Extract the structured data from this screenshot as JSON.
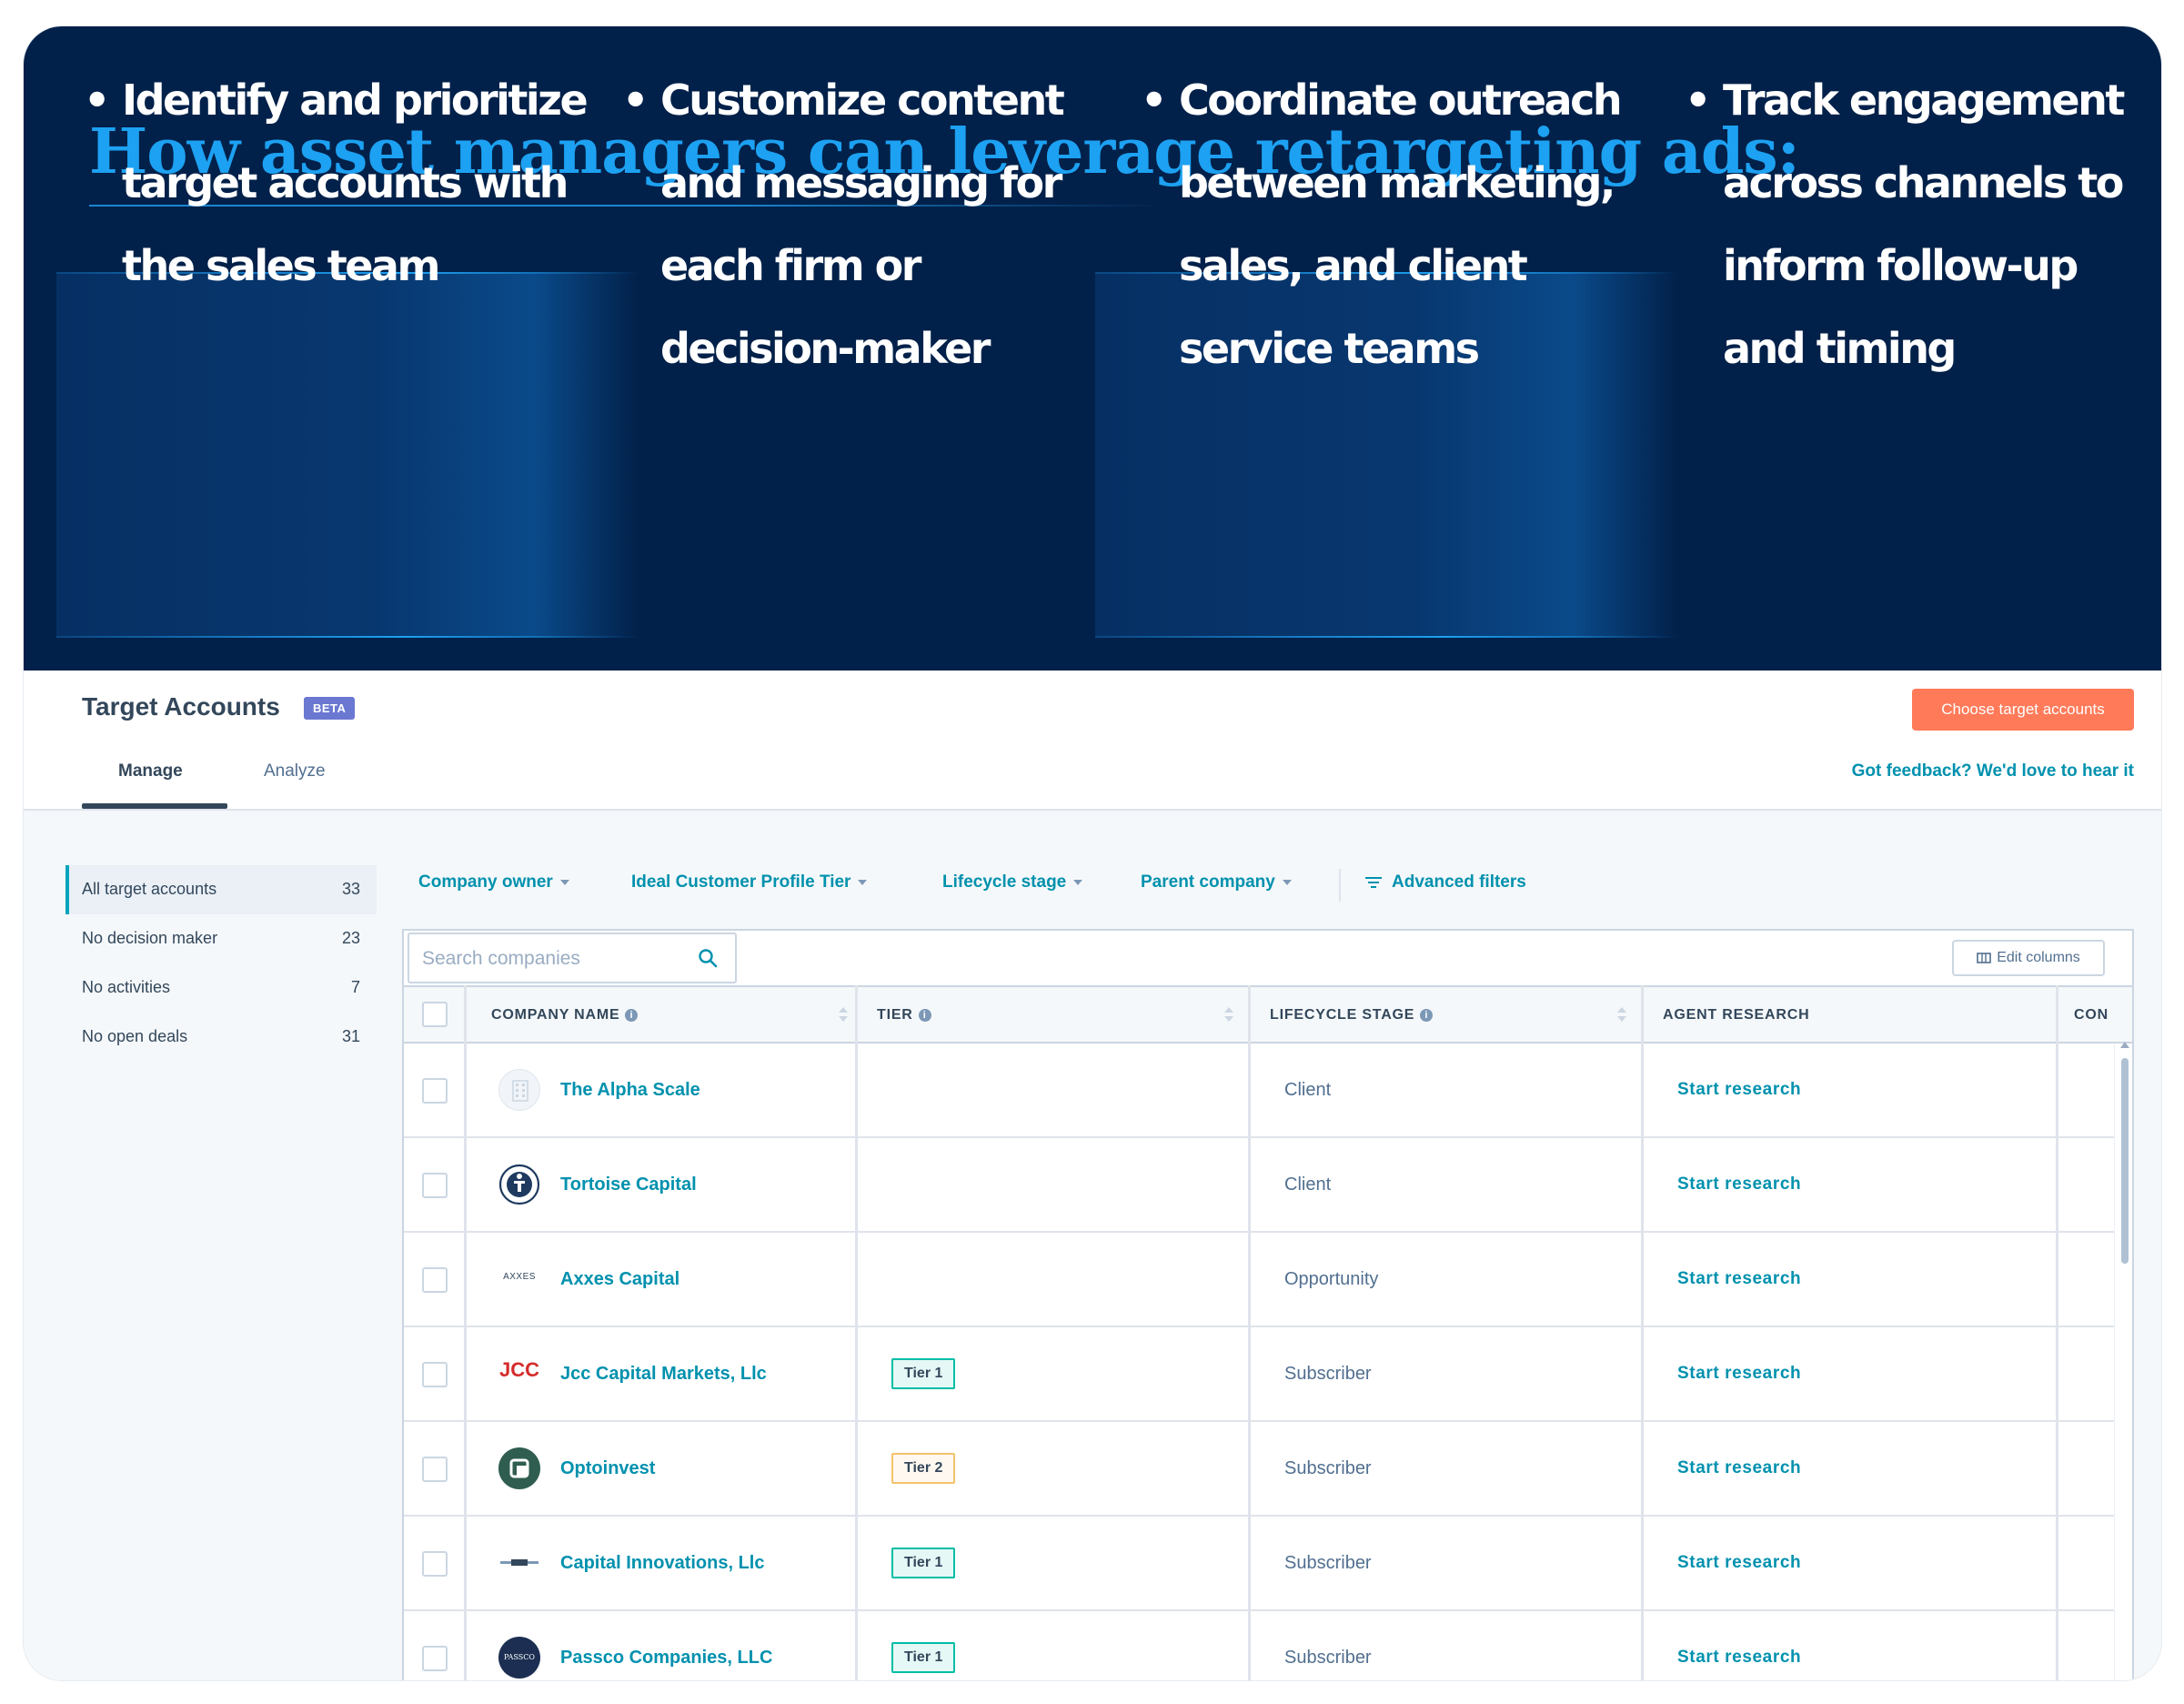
{
  "hero": {
    "title": "How asset managers can leverage retargeting ads:",
    "bullets": [
      "Identify and prioritize\ntarget accounts with\nthe sales team",
      "Customize content\nand messaging for\neach firm or\ndecision-maker",
      "Coordinate outreach\nbetween marketing,\nsales, and client\nservice teams",
      "Track engagement\nacross channels to\ninform follow-up\nand timing"
    ],
    "bullet_glyph": "•"
  },
  "app": {
    "title": "Target Accounts",
    "badge": "BETA",
    "primary_button": "Choose target accounts",
    "tabs": [
      "Manage",
      "Analyze"
    ],
    "feedback_link": "Got feedback? We'd love to hear it"
  },
  "sidebar": {
    "items": [
      {
        "label": "All target accounts",
        "count": "33"
      },
      {
        "label": "No decision maker",
        "count": "23"
      },
      {
        "label": "No activities",
        "count": "7"
      },
      {
        "label": "No open deals",
        "count": "31"
      }
    ]
  },
  "filters": {
    "company_owner": "Company owner",
    "icp_tier": "Ideal Customer Profile Tier",
    "lifecycle_stage": "Lifecycle stage",
    "parent_company": "Parent company",
    "advanced": "Advanced filters"
  },
  "search": {
    "placeholder": "Search companies"
  },
  "edit_columns": "Edit columns",
  "table": {
    "headers": [
      "COMPANY NAME",
      "TIER",
      "LIFECYCLE STAGE",
      "AGENT RESEARCH",
      "CON"
    ],
    "rows": [
      {
        "name": "The Alpha Scale",
        "tier": "",
        "stage": "Client",
        "research": "Start research"
      },
      {
        "name": "Tortoise Capital",
        "tier": "",
        "stage": "Client",
        "research": "Start research"
      },
      {
        "name": "Axxes Capital",
        "tier": "",
        "stage": "Opportunity",
        "research": "Start research"
      },
      {
        "name": "Jcc Capital Markets, Llc",
        "tier": "Tier 1",
        "stage": "Subscriber",
        "research": "Start research"
      },
      {
        "name": "Optoinvest",
        "tier": "Tier 2",
        "stage": "Subscriber",
        "research": "Start research"
      },
      {
        "name": "Capital Innovations, Llc",
        "tier": "Tier 1",
        "stage": "Subscriber",
        "research": "Start research"
      },
      {
        "name": "Passco Companies, LLC",
        "tier": "Tier 1",
        "stage": "Subscriber",
        "research": "Start research"
      }
    ],
    "logo_marks": {
      "axxes": "AXXES",
      "jcc": "JCC",
      "passco": "PASSCO"
    }
  },
  "colors": {
    "hero_bg": "#02214a",
    "hero_accent": "#1da1f2",
    "link": "#0091ae",
    "primary_button": "#ff7a59",
    "beta_badge": "#6a78d1"
  }
}
